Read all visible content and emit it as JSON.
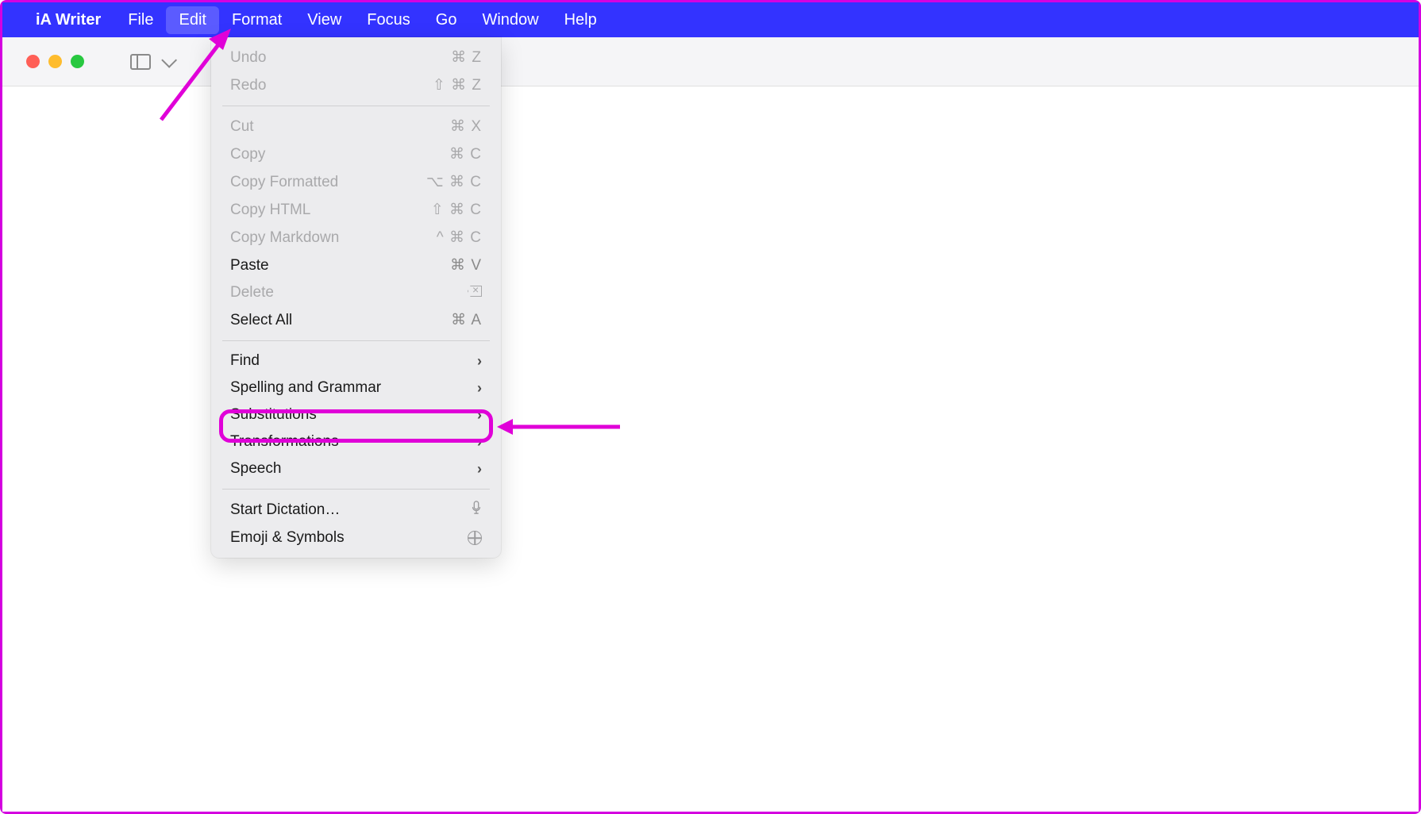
{
  "menubar": {
    "app_name": "iA Writer",
    "items": [
      "File",
      "Edit",
      "Format",
      "View",
      "Focus",
      "Go",
      "Window",
      "Help"
    ],
    "active_index": 1
  },
  "edit_menu": {
    "groups": [
      [
        {
          "label": "Undo",
          "shortcut": "⌘ Z",
          "enabled": false
        },
        {
          "label": "Redo",
          "shortcut": "⇧ ⌘ Z",
          "enabled": false
        }
      ],
      [
        {
          "label": "Cut",
          "shortcut": "⌘ X",
          "enabled": false
        },
        {
          "label": "Copy",
          "shortcut": "⌘ C",
          "enabled": false
        },
        {
          "label": "Copy Formatted",
          "shortcut": "⌥ ⌘ C",
          "enabled": false
        },
        {
          "label": "Copy HTML",
          "shortcut": "⇧ ⌘ C",
          "enabled": false
        },
        {
          "label": "Copy Markdown",
          "shortcut": "^ ⌘ C",
          "enabled": false
        },
        {
          "label": "Paste",
          "shortcut": "⌘ V",
          "enabled": true
        },
        {
          "label": "Delete",
          "shortcut": "",
          "enabled": false,
          "icon": "delete"
        },
        {
          "label": "Select All",
          "shortcut": "⌘ A",
          "enabled": true
        }
      ],
      [
        {
          "label": "Find",
          "submenu": true,
          "enabled": true
        },
        {
          "label": "Spelling and Grammar",
          "submenu": true,
          "enabled": true
        },
        {
          "label": "Substitutions",
          "submenu": true,
          "enabled": true,
          "highlighted": true
        },
        {
          "label": "Transformations",
          "submenu": true,
          "enabled": true
        },
        {
          "label": "Speech",
          "submenu": true,
          "enabled": true
        }
      ],
      [
        {
          "label": "Start Dictation…",
          "enabled": true,
          "icon": "mic"
        },
        {
          "label": "Emoji & Symbols",
          "enabled": true,
          "icon": "globe"
        }
      ]
    ]
  },
  "annotations": {
    "highlight_target": "Substitutions",
    "colors": {
      "accent": "#e000d8",
      "menubar": "#3333ff"
    }
  }
}
